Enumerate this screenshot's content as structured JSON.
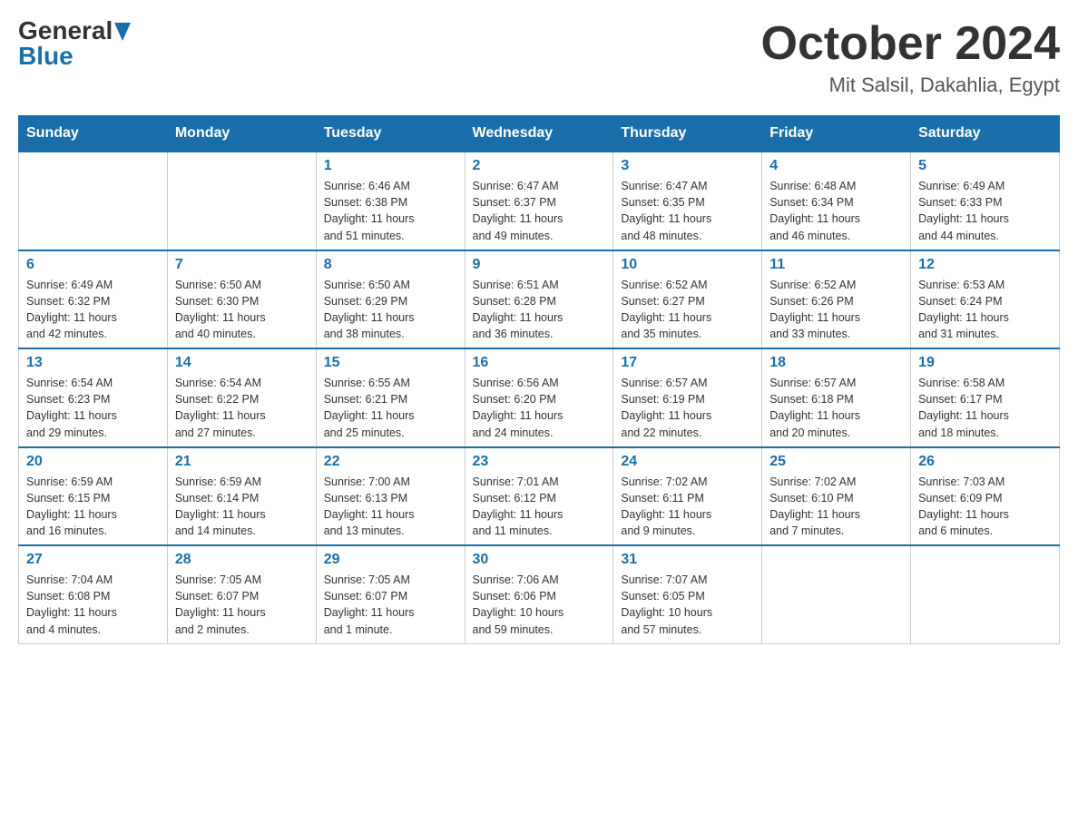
{
  "header": {
    "logo_general": "General",
    "logo_blue": "Blue",
    "month_year": "October 2024",
    "location": "Mit Salsil, Dakahlia, Egypt"
  },
  "weekdays": [
    "Sunday",
    "Monday",
    "Tuesday",
    "Wednesday",
    "Thursday",
    "Friday",
    "Saturday"
  ],
  "weeks": [
    [
      {
        "day": "",
        "info": ""
      },
      {
        "day": "",
        "info": ""
      },
      {
        "day": "1",
        "info": "Sunrise: 6:46 AM\nSunset: 6:38 PM\nDaylight: 11 hours\nand 51 minutes."
      },
      {
        "day": "2",
        "info": "Sunrise: 6:47 AM\nSunset: 6:37 PM\nDaylight: 11 hours\nand 49 minutes."
      },
      {
        "day": "3",
        "info": "Sunrise: 6:47 AM\nSunset: 6:35 PM\nDaylight: 11 hours\nand 48 minutes."
      },
      {
        "day": "4",
        "info": "Sunrise: 6:48 AM\nSunset: 6:34 PM\nDaylight: 11 hours\nand 46 minutes."
      },
      {
        "day": "5",
        "info": "Sunrise: 6:49 AM\nSunset: 6:33 PM\nDaylight: 11 hours\nand 44 minutes."
      }
    ],
    [
      {
        "day": "6",
        "info": "Sunrise: 6:49 AM\nSunset: 6:32 PM\nDaylight: 11 hours\nand 42 minutes."
      },
      {
        "day": "7",
        "info": "Sunrise: 6:50 AM\nSunset: 6:30 PM\nDaylight: 11 hours\nand 40 minutes."
      },
      {
        "day": "8",
        "info": "Sunrise: 6:50 AM\nSunset: 6:29 PM\nDaylight: 11 hours\nand 38 minutes."
      },
      {
        "day": "9",
        "info": "Sunrise: 6:51 AM\nSunset: 6:28 PM\nDaylight: 11 hours\nand 36 minutes."
      },
      {
        "day": "10",
        "info": "Sunrise: 6:52 AM\nSunset: 6:27 PM\nDaylight: 11 hours\nand 35 minutes."
      },
      {
        "day": "11",
        "info": "Sunrise: 6:52 AM\nSunset: 6:26 PM\nDaylight: 11 hours\nand 33 minutes."
      },
      {
        "day": "12",
        "info": "Sunrise: 6:53 AM\nSunset: 6:24 PM\nDaylight: 11 hours\nand 31 minutes."
      }
    ],
    [
      {
        "day": "13",
        "info": "Sunrise: 6:54 AM\nSunset: 6:23 PM\nDaylight: 11 hours\nand 29 minutes."
      },
      {
        "day": "14",
        "info": "Sunrise: 6:54 AM\nSunset: 6:22 PM\nDaylight: 11 hours\nand 27 minutes."
      },
      {
        "day": "15",
        "info": "Sunrise: 6:55 AM\nSunset: 6:21 PM\nDaylight: 11 hours\nand 25 minutes."
      },
      {
        "day": "16",
        "info": "Sunrise: 6:56 AM\nSunset: 6:20 PM\nDaylight: 11 hours\nand 24 minutes."
      },
      {
        "day": "17",
        "info": "Sunrise: 6:57 AM\nSunset: 6:19 PM\nDaylight: 11 hours\nand 22 minutes."
      },
      {
        "day": "18",
        "info": "Sunrise: 6:57 AM\nSunset: 6:18 PM\nDaylight: 11 hours\nand 20 minutes."
      },
      {
        "day": "19",
        "info": "Sunrise: 6:58 AM\nSunset: 6:17 PM\nDaylight: 11 hours\nand 18 minutes."
      }
    ],
    [
      {
        "day": "20",
        "info": "Sunrise: 6:59 AM\nSunset: 6:15 PM\nDaylight: 11 hours\nand 16 minutes."
      },
      {
        "day": "21",
        "info": "Sunrise: 6:59 AM\nSunset: 6:14 PM\nDaylight: 11 hours\nand 14 minutes."
      },
      {
        "day": "22",
        "info": "Sunrise: 7:00 AM\nSunset: 6:13 PM\nDaylight: 11 hours\nand 13 minutes."
      },
      {
        "day": "23",
        "info": "Sunrise: 7:01 AM\nSunset: 6:12 PM\nDaylight: 11 hours\nand 11 minutes."
      },
      {
        "day": "24",
        "info": "Sunrise: 7:02 AM\nSunset: 6:11 PM\nDaylight: 11 hours\nand 9 minutes."
      },
      {
        "day": "25",
        "info": "Sunrise: 7:02 AM\nSunset: 6:10 PM\nDaylight: 11 hours\nand 7 minutes."
      },
      {
        "day": "26",
        "info": "Sunrise: 7:03 AM\nSunset: 6:09 PM\nDaylight: 11 hours\nand 6 minutes."
      }
    ],
    [
      {
        "day": "27",
        "info": "Sunrise: 7:04 AM\nSunset: 6:08 PM\nDaylight: 11 hours\nand 4 minutes."
      },
      {
        "day": "28",
        "info": "Sunrise: 7:05 AM\nSunset: 6:07 PM\nDaylight: 11 hours\nand 2 minutes."
      },
      {
        "day": "29",
        "info": "Sunrise: 7:05 AM\nSunset: 6:07 PM\nDaylight: 11 hours\nand 1 minute."
      },
      {
        "day": "30",
        "info": "Sunrise: 7:06 AM\nSunset: 6:06 PM\nDaylight: 10 hours\nand 59 minutes."
      },
      {
        "day": "31",
        "info": "Sunrise: 7:07 AM\nSunset: 6:05 PM\nDaylight: 10 hours\nand 57 minutes."
      },
      {
        "day": "",
        "info": ""
      },
      {
        "day": "",
        "info": ""
      }
    ]
  ]
}
